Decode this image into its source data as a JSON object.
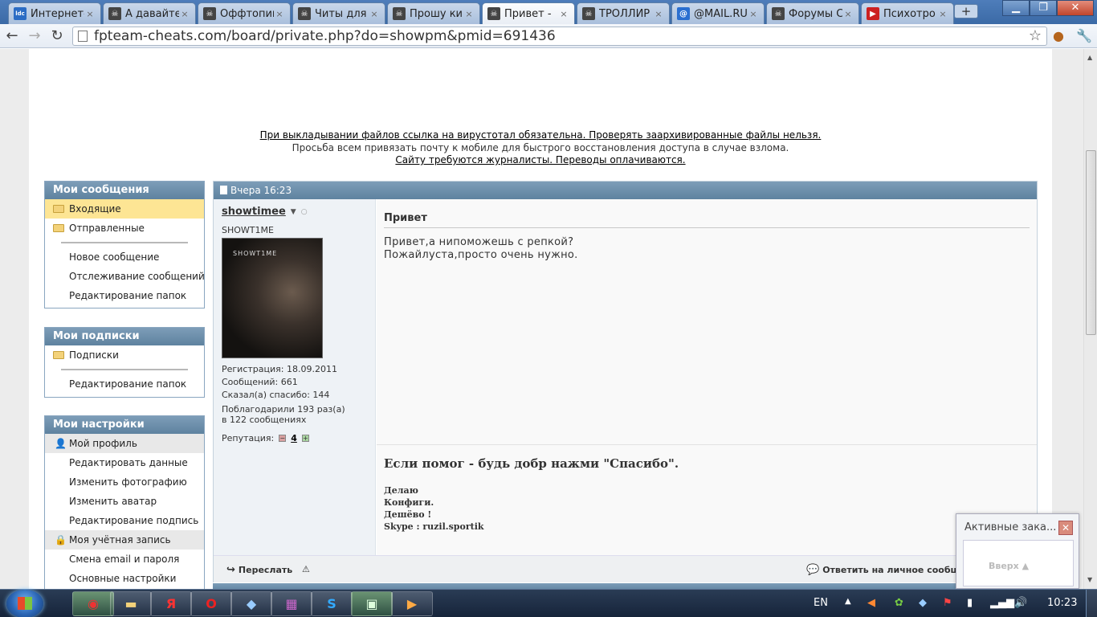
{
  "browser": {
    "tabs": [
      {
        "title": "Интернет-",
        "icon": "ldc-icon",
        "color": "#2b6cc4"
      },
      {
        "title": "А давайте",
        "icon": "skull-icon",
        "color": "#444444"
      },
      {
        "title": "Оффтопик",
        "icon": "skull-icon",
        "color": "#444444"
      },
      {
        "title": "Читы для",
        "icon": "skull-icon",
        "color": "#444444"
      },
      {
        "title": "Прошу ки",
        "icon": "skull-icon",
        "color": "#444444"
      },
      {
        "title": "Привет -",
        "icon": "skull-icon",
        "color": "#444444",
        "active": true
      },
      {
        "title": "ТРОЛЛИР",
        "icon": "skull-icon",
        "color": "#444444"
      },
      {
        "title": "@MAIL.RU",
        "icon": "mail-icon",
        "color": "#2a6fd0"
      },
      {
        "title": "Форумы С",
        "icon": "forum-icon",
        "color": "#444444"
      },
      {
        "title": "Психотро",
        "icon": "youtube-icon",
        "color": "#cc2020"
      }
    ],
    "url": "fpteam-cheats.com/board/private.php?do=showpm&pmid=691436"
  },
  "notices": {
    "line1": "При выкладывании файлов ссылка на вирустотал обязательна. Проверять заархивированные файлы нельзя.",
    "line2": "Просьба всем привязать почту к мобиле для быстрого восстановления доступа в случае взлома.",
    "line3": "Сайту требуются журналисты. Переводы оплачиваются."
  },
  "sidebar": {
    "messages": {
      "title": "Мои сообщения",
      "inbox": "Входящие",
      "sent": "Отправленные",
      "new": "Новое сообщение",
      "tracking": "Отслеживание сообщений",
      "edit_folders": "Редактирование папок"
    },
    "subscriptions": {
      "title": "Мои подписки",
      "subs": "Подписки",
      "edit_folders": "Редактирование папок"
    },
    "settings": {
      "title": "Мои настройки",
      "profile": "Мой профиль",
      "edit_data": "Редактировать данные",
      "change_photo": "Изменить фотографию",
      "change_avatar": "Изменить аватар",
      "edit_signature": "Редактирование подпись",
      "account": "Моя учётная запись",
      "change_email": "Смена email и пароля",
      "main_settings": "Основные настройки"
    }
  },
  "message": {
    "date": "Вчера 16:23",
    "user": {
      "name": "showtimee",
      "title": "SHOWT1ME",
      "avatar_text": "SHOWT1ME",
      "reg": "Регистрация:   18.09.2011",
      "posts": "Сообщений:   661",
      "thanks_said": "Сказал(а) спасибо:   144",
      "thanked": "Поблагодарили 193 раз(а)",
      "thanked_in": "в 122 сообщениях",
      "rep_label": "Репутация:",
      "rep_value": "4"
    },
    "subject": "Привет",
    "body1": "Привет,а нипоможешь с репкой?",
    "body2": "Пожайлуста,просто очень нужно.",
    "sig_title": "Если помог - будь добр нажми \"Спасибо\".",
    "sig1": "Делаю",
    "sig2": "Конфиги.",
    "sig3": "Дешёво !",
    "sig4": "Skype : ruzil.sportik",
    "forward": "Переслать",
    "reply": "Ответить на личное сообщение"
  },
  "popup": {
    "title": "Активные зака...",
    "up": "Вверх ▲"
  },
  "taskbar": {
    "lang": "EN",
    "time": "10:23"
  }
}
